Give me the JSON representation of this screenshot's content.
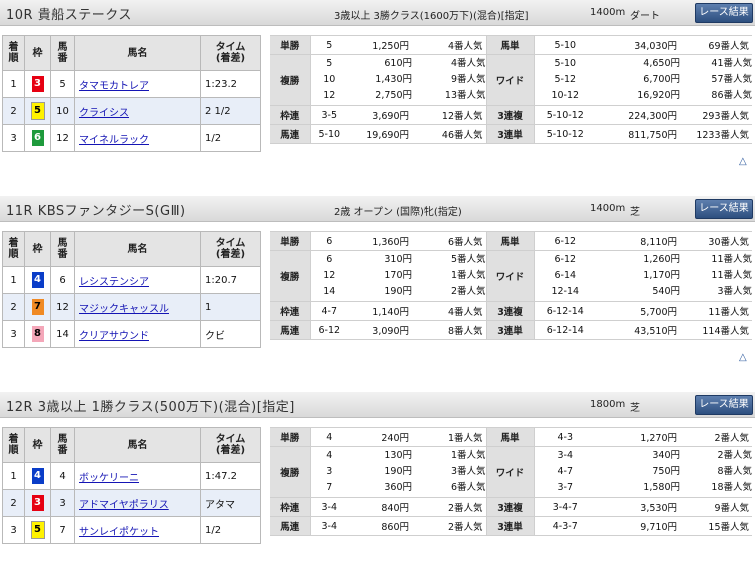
{
  "races": [
    {
      "title": "10R 貴船ステークス",
      "conditions": "3歳以上 3勝クラス(1600万下)(混合)[指定]",
      "distance": "1400m",
      "surface": "ダート",
      "race_button": "レース結果",
      "col_headers": {
        "rank": "着\n順",
        "waku": "枠",
        "umaban": "馬\n番",
        "name": "馬名",
        "time": "タイム\n(着差)"
      },
      "results": [
        {
          "rank": "1",
          "waku": "3",
          "waku_bg": "#e60012",
          "waku_fg": "#ffffff",
          "umaban": "5",
          "name": "タマモカトレア",
          "time": "1:23.2"
        },
        {
          "rank": "2",
          "waku": "5",
          "waku_bg": "#fff200",
          "waku_fg": "#000000",
          "umaban": "10",
          "name": "クライシス",
          "time": "2 1/2"
        },
        {
          "rank": "3",
          "waku": "6",
          "waku_bg": "#1e9a3c",
          "waku_fg": "#ffffff",
          "umaban": "12",
          "name": "マイネルラック",
          "time": "1/2"
        }
      ],
      "payouts": {
        "tansho": {
          "label": "単勝",
          "combo": "5",
          "amount": "1,250円",
          "pop": "4番人気"
        },
        "fukusho": {
          "label": "複勝",
          "rows": [
            {
              "combo": "5",
              "amount": "610円",
              "pop": "4番人気"
            },
            {
              "combo": "10",
              "amount": "1,430円",
              "pop": "9番人気"
            },
            {
              "combo": "12",
              "amount": "2,750円",
              "pop": "13番人気"
            }
          ]
        },
        "wakuren": {
          "label": "枠連",
          "combo": "3-5",
          "amount": "3,690円",
          "pop": "12番人気"
        },
        "umaren": {
          "label": "馬連",
          "combo": "5-10",
          "amount": "19,690円",
          "pop": "46番人気"
        },
        "umatan": {
          "label": "馬単",
          "combo": "5-10",
          "amount": "34,030円",
          "pop": "69番人気"
        },
        "wide": {
          "label": "ワイド",
          "rows": [
            {
              "combo": "5-10",
              "amount": "4,650円",
              "pop": "41番人気"
            },
            {
              "combo": "5-12",
              "amount": "6,700円",
              "pop": "57番人気"
            },
            {
              "combo": "10-12",
              "amount": "16,920円",
              "pop": "86番人気"
            }
          ]
        },
        "sanrenpuku": {
          "label": "3連複",
          "combo": "5-10-12",
          "amount": "224,300円",
          "pop": "293番人気"
        },
        "sanrentan": {
          "label": "3連単",
          "combo": "5-10-12",
          "amount": "811,750円",
          "pop": "1233番人気"
        }
      }
    },
    {
      "title": "11R KBSファンタジーS(GⅢ)",
      "conditions": "2歳 オープン (国際)牝(指定)",
      "distance": "1400m",
      "surface": "芝",
      "race_button": "レース結果",
      "col_headers": {
        "rank": "着\n順",
        "waku": "枠",
        "umaban": "馬\n番",
        "name": "馬名",
        "time": "タイム\n(着差)"
      },
      "results": [
        {
          "rank": "1",
          "waku": "4",
          "waku_bg": "#0a3dc8",
          "waku_fg": "#ffffff",
          "umaban": "6",
          "name": "レシステンシア",
          "time": "1:20.7"
        },
        {
          "rank": "2",
          "waku": "7",
          "waku_bg": "#f08a24",
          "waku_fg": "#000000",
          "umaban": "12",
          "name": "マジックキャッスル",
          "time": "1"
        },
        {
          "rank": "3",
          "waku": "8",
          "waku_bg": "#f4a7b9",
          "waku_fg": "#000000",
          "umaban": "14",
          "name": "クリアサウンド",
          "time": "クビ"
        }
      ],
      "payouts": {
        "tansho": {
          "label": "単勝",
          "combo": "6",
          "amount": "1,360円",
          "pop": "6番人気"
        },
        "fukusho": {
          "label": "複勝",
          "rows": [
            {
              "combo": "6",
              "amount": "310円",
              "pop": "5番人気"
            },
            {
              "combo": "12",
              "amount": "170円",
              "pop": "1番人気"
            },
            {
              "combo": "14",
              "amount": "190円",
              "pop": "2番人気"
            }
          ]
        },
        "wakuren": {
          "label": "枠連",
          "combo": "4-7",
          "amount": "1,140円",
          "pop": "4番人気"
        },
        "umaren": {
          "label": "馬連",
          "combo": "6-12",
          "amount": "3,090円",
          "pop": "8番人気"
        },
        "umatan": {
          "label": "馬単",
          "combo": "6-12",
          "amount": "8,110円",
          "pop": "30番人気"
        },
        "wide": {
          "label": "ワイド",
          "rows": [
            {
              "combo": "6-12",
              "amount": "1,260円",
              "pop": "11番人気"
            },
            {
              "combo": "6-14",
              "amount": "1,170円",
              "pop": "11番人気"
            },
            {
              "combo": "12-14",
              "amount": "540円",
              "pop": "3番人気"
            }
          ]
        },
        "sanrenpuku": {
          "label": "3連複",
          "combo": "6-12-14",
          "amount": "5,700円",
          "pop": "11番人気"
        },
        "sanrentan": {
          "label": "3連単",
          "combo": "6-12-14",
          "amount": "43,510円",
          "pop": "114番人気"
        }
      }
    },
    {
      "title": "12R 3歳以上 1勝クラス(500万下)(混合)[指定]",
      "conditions": "",
      "distance": "1800m",
      "surface": "芝",
      "race_button": "レース結果",
      "col_headers": {
        "rank": "着\n順",
        "waku": "枠",
        "umaban": "馬\n番",
        "name": "馬名",
        "time": "タイム\n(着差)"
      },
      "results": [
        {
          "rank": "1",
          "waku": "4",
          "waku_bg": "#0a3dc8",
          "waku_fg": "#ffffff",
          "umaban": "4",
          "name": "ボッケリーニ",
          "time": "1:47.2"
        },
        {
          "rank": "2",
          "waku": "3",
          "waku_bg": "#e60012",
          "waku_fg": "#ffffff",
          "umaban": "3",
          "name": "アドマイヤポラリス",
          "time": "アタマ"
        },
        {
          "rank": "3",
          "waku": "5",
          "waku_bg": "#fff200",
          "waku_fg": "#000000",
          "umaban": "7",
          "name": "サンレイポケット",
          "time": "1/2"
        }
      ],
      "payouts": {
        "tansho": {
          "label": "単勝",
          "combo": "4",
          "amount": "240円",
          "pop": "1番人気"
        },
        "fukusho": {
          "label": "複勝",
          "rows": [
            {
              "combo": "4",
              "amount": "130円",
              "pop": "1番人気"
            },
            {
              "combo": "3",
              "amount": "190円",
              "pop": "3番人気"
            },
            {
              "combo": "7",
              "amount": "360円",
              "pop": "6番人気"
            }
          ]
        },
        "wakuren": {
          "label": "枠連",
          "combo": "3-4",
          "amount": "840円",
          "pop": "2番人気"
        },
        "umaren": {
          "label": "馬連",
          "combo": "3-4",
          "amount": "860円",
          "pop": "2番人気"
        },
        "umatan": {
          "label": "馬単",
          "combo": "4-3",
          "amount": "1,270円",
          "pop": "2番人気"
        },
        "wide": {
          "label": "ワイド",
          "rows": [
            {
              "combo": "3-4",
              "amount": "340円",
              "pop": "2番人気"
            },
            {
              "combo": "4-7",
              "amount": "750円",
              "pop": "8番人気"
            },
            {
              "combo": "3-7",
              "amount": "1,580円",
              "pop": "18番人気"
            }
          ]
        },
        "sanrenpuku": {
          "label": "3連複",
          "combo": "3-4-7",
          "amount": "3,530円",
          "pop": "9番人気"
        },
        "sanrentan": {
          "label": "3連単",
          "combo": "4-3-7",
          "amount": "9,710円",
          "pop": "15番人気"
        }
      }
    }
  ],
  "page_top_glyph": "△"
}
